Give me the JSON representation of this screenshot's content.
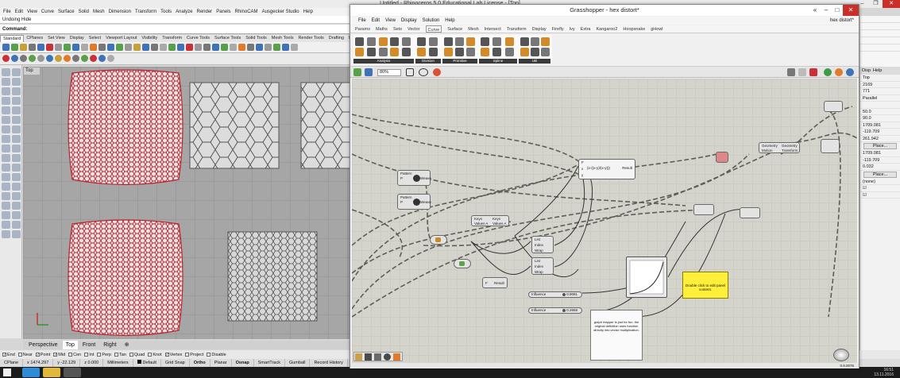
{
  "rhino": {
    "title": "Untitled - Rhinoceros 5.0 Educational Lab License - [Top]",
    "menu": [
      "File",
      "Edit",
      "View",
      "Curve",
      "Surface",
      "Solid",
      "Mesh",
      "Dimension",
      "Transform",
      "Tools",
      "Analyze",
      "Render",
      "Panels",
      "RhinoCAM",
      "Ausgecker Studio",
      "Help"
    ],
    "command_history": "Undoing Hide",
    "command_label": "Command:",
    "toolbar_tabs": [
      "Standard",
      "CPlanes",
      "Set View",
      "Display",
      "Select",
      "Viewport Layout",
      "Visibility",
      "Transform",
      "Curve Tools",
      "Surface Tools",
      "Solid Tools",
      "Mesh Tools",
      "Render Tools",
      "Drafting",
      "New in"
    ],
    "active_toolbar_tab": "Standard",
    "viewport_name": "Top",
    "viewport_tabs": [
      "Perspective",
      "Top",
      "Front",
      "Right"
    ],
    "active_viewport_tab": "Top",
    "add_viewport_glyph": "⊕",
    "osnaps": [
      {
        "label": "End",
        "checked": true
      },
      {
        "label": "Near",
        "checked": false
      },
      {
        "label": "Point",
        "checked": true
      },
      {
        "label": "Mid",
        "checked": true
      },
      {
        "label": "Cen",
        "checked": false
      },
      {
        "label": "Int",
        "checked": false
      },
      {
        "label": "Perp",
        "checked": false
      },
      {
        "label": "Tan",
        "checked": false
      },
      {
        "label": "Quad",
        "checked": false
      },
      {
        "label": "Knot",
        "checked": false
      },
      {
        "label": "Vertex",
        "checked": true
      },
      {
        "label": "Project",
        "checked": false
      },
      {
        "label": "Disable",
        "checked": false
      }
    ],
    "status": {
      "cplane": "CPlane",
      "x": "x 1474.297",
      "y": "y -22.129",
      "z": "z 0.000",
      "units": "Millimeters",
      "layer": "Default",
      "toggles": [
        "Grid Snap",
        "Ortho",
        "Planar",
        "Osnap",
        "SmartTrack",
        "Gumball",
        "Record History",
        "Filter"
      ],
      "bold_toggles": [
        "Ortho",
        "Osnap"
      ]
    },
    "right_panel": {
      "tabs": [
        "Disp",
        "Help"
      ],
      "rows": [
        "Top",
        "2169",
        "771",
        "Parallel",
        "",
        "50.0",
        "90.0",
        "1709.081",
        "-119.709",
        "261.942"
      ],
      "button1": "Place...",
      "rows2": [
        "1709.081",
        "-119.709",
        "0.032"
      ],
      "button2": "Place...",
      "rows3": [
        "(none)"
      ]
    }
  },
  "grasshopper": {
    "title": "Grasshopper - hex distort*",
    "doc_name": "hex distort*",
    "menu": [
      "File",
      "Edit",
      "View",
      "Display",
      "Solution",
      "Help"
    ],
    "category_tabs": [
      "Params",
      "Maths",
      "Sets",
      "Vector",
      "Curve",
      "Surface",
      "Mesh",
      "Intersect",
      "Transform",
      "Display",
      "Firefly",
      "Ivy",
      "Extra",
      "Kangaroo2",
      "Hoopsnake",
      "gHowl"
    ],
    "active_category": "Curve",
    "ribbon_groups": [
      "Analysis",
      "Division",
      "Primitive",
      "Spline",
      "Util"
    ],
    "zoom": "80%",
    "components": {
      "weave1": {
        "title": "Pattern",
        "name": "Weave",
        "in": "P",
        "out": "W"
      },
      "weave2": {
        "title": "Pattern",
        "name": "Weave",
        "in": "P",
        "out": "W"
      },
      "expression": {
        "formula": "(x-((x-y)/(x-y)))",
        "in_vars": [
          "F",
          "x",
          "y"
        ],
        "out": "Result"
      },
      "geometry1": {
        "name": "Geometry",
        "sub": "Motion"
      },
      "geometry2": {
        "name": "Geometry",
        "sub": "Transform"
      },
      "keys_values_a": {
        "l1": "Keys",
        "l2": "Values A"
      },
      "keys_values_b": {
        "l1": "Keys",
        "l2": "Values A"
      },
      "list_item1": {
        "l1": "List",
        "l2": "Index",
        "l3": "Wrap"
      },
      "list_item2": {
        "l1": "List",
        "l2": "Index",
        "l3": "Wrap"
      },
      "eval_result": {
        "in": "F",
        "out": "Result"
      },
      "panel_yellow": "Double click to edit panel content.",
      "panel_note": "graph mapper is just for fun. the original definition uses function directly into vector multiplication.",
      "influence1": {
        "label": "Influence",
        "value": "0.9081"
      },
      "influence2": {
        "label": "Influence",
        "value": "0.2658"
      }
    },
    "status_right": "0.9.0076"
  },
  "taskbar": {
    "time": "16:51",
    "date": "13.11.2016"
  },
  "colors": {
    "accent_red": "#c8303a",
    "gh_canvas": "#d4d4cc",
    "panel_yellow": "#ffef3a",
    "close_red": "#c9302c"
  }
}
